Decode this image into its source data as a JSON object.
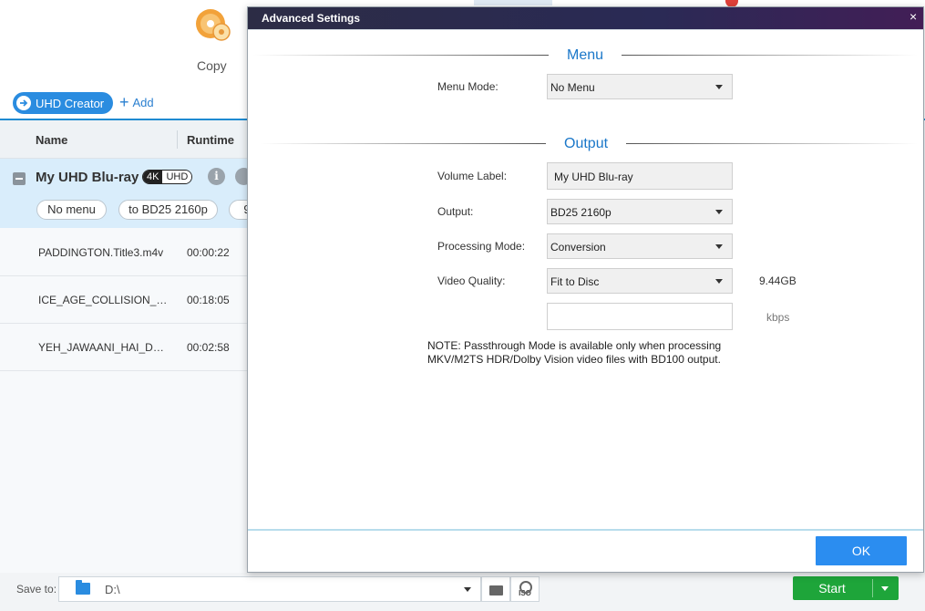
{
  "app": {
    "copy_label": "Copy",
    "uhd_creator_label": "UHD Creator",
    "add_label": "Add",
    "columns": {
      "name": "Name",
      "runtime": "Runtime"
    },
    "project": {
      "title": "My UHD Blu-ray",
      "badge_a": "4K",
      "badge_b": "UHD",
      "pills": [
        "No menu",
        "to BD25 2160p",
        "9"
      ]
    },
    "files": [
      {
        "name": "PADDINGTON.Title3.m4v",
        "runtime": "00:00:22"
      },
      {
        "name": "ICE_AGE_COLLISION_COURSE",
        "runtime": "00:18:05"
      },
      {
        "name": "YEH_JAWAANI_HAI_DEEWANI",
        "runtime": "00:02:58"
      }
    ],
    "save_to_label": "Save to:",
    "save_path": "D:\\",
    "iso_label": "ISO",
    "start_label": "Start"
  },
  "dialog": {
    "title": "Advanced Settings",
    "close_glyph": "×",
    "menu_section": "Menu",
    "menu_mode_label": "Menu Mode:",
    "menu_mode_value": "No Menu",
    "output_section": "Output",
    "volume_label_label": "Volume Label:",
    "volume_label_value": "My UHD Blu-ray",
    "output_label": "Output:",
    "output_value": "BD25 2160p",
    "processing_mode_label": "Processing Mode:",
    "processing_mode_value": "Conversion",
    "video_quality_label": "Video Quality:",
    "video_quality_value": "Fit to Disc",
    "size_value": "9.44GB",
    "bitrate_value": "",
    "bitrate_unit": "kbps",
    "note_line1": "NOTE: Passthrough Mode is available only when processing",
    "note_line2": "MKV/M2TS HDR/Dolby Vision video files with BD100 output.",
    "ok_label": "OK"
  },
  "colors": {
    "accent_blue": "#2b8df0",
    "section_blue": "#1a77c9",
    "start_green": "#1ea53a",
    "title_bar": "#2a2a55"
  }
}
